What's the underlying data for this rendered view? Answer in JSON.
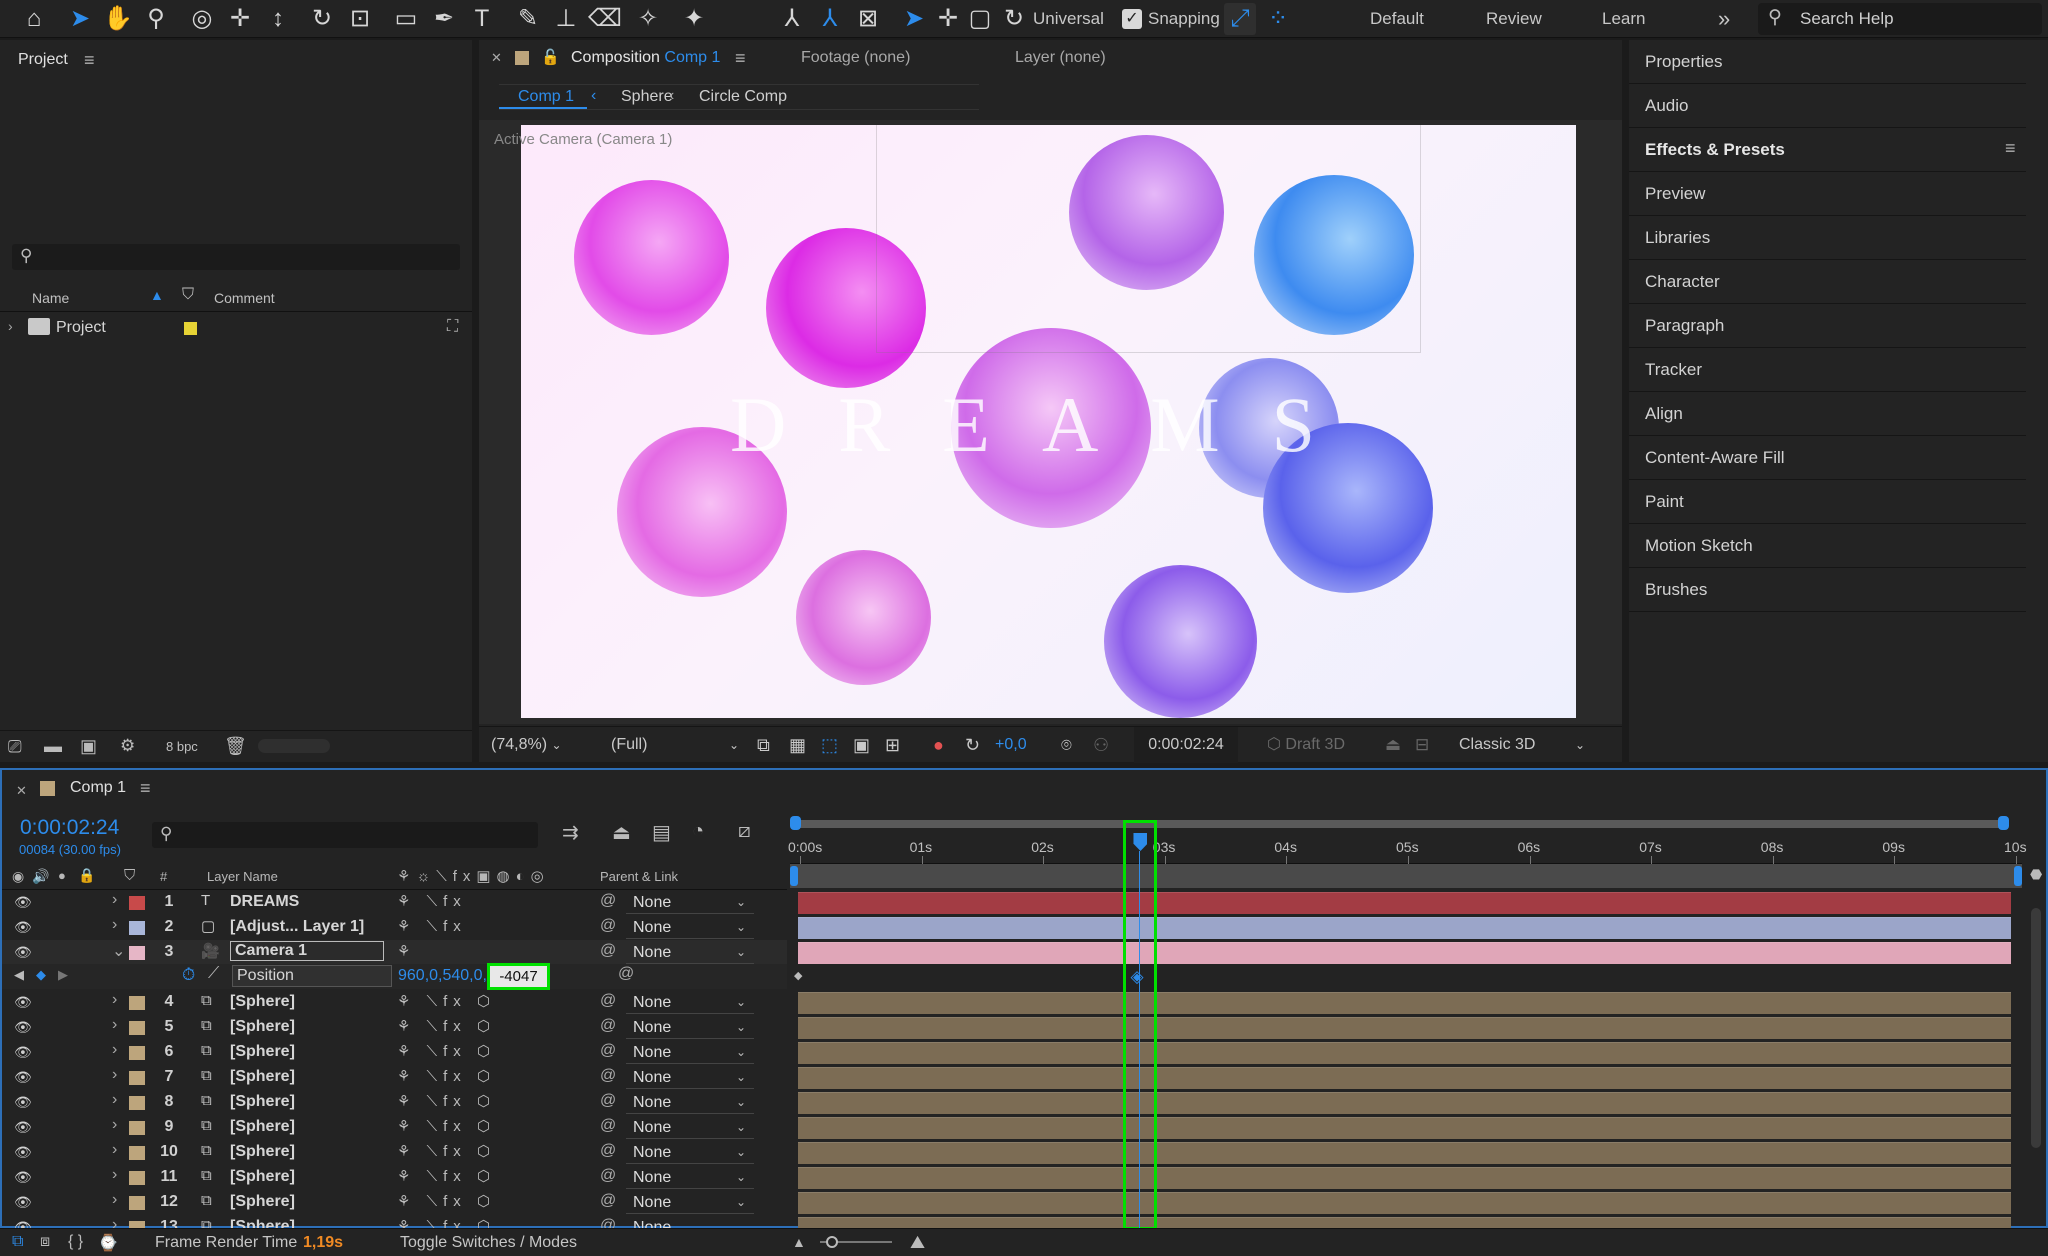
{
  "toolbar": {
    "axis_mode": "Universal",
    "snapping": "Snapping",
    "workspaces": [
      "Default",
      "Review",
      "Learn"
    ],
    "more": "»",
    "search_placeholder": "Search Help"
  },
  "project": {
    "title": "Project",
    "search_placeholder": "",
    "columns": {
      "name": "Name",
      "comment": "Comment"
    },
    "items": [
      {
        "name": "Project",
        "label_color": "#e6d335"
      }
    ],
    "bpc": "8 bpc"
  },
  "viewer": {
    "tab_composition": "Composition",
    "tab_comp_name": "Comp 1",
    "tab_footage": "Footage (none)",
    "tab_layer": "Layer (none)",
    "breadcrumbs": [
      "Comp 1",
      "Sphere",
      "Circle Comp"
    ],
    "camera_label": "Active Camera (Camera 1)",
    "canvas_text": "DREAMS",
    "zoom": "(74,8%)",
    "resolution": "(Full)",
    "exposure": "+0,0",
    "timecode": "0:00:02:24",
    "draft3d": "Draft 3D",
    "renderer": "Classic 3D"
  },
  "right_panel": {
    "items": [
      "Properties",
      "Audio",
      "Effects & Presets",
      "Preview",
      "Libraries",
      "Character",
      "Paragraph",
      "Tracker",
      "Align",
      "Content-Aware Fill",
      "Paint",
      "Motion Sketch",
      "Brushes"
    ]
  },
  "timeline": {
    "tab": "Comp 1",
    "timecode": "0:00:02:24",
    "frames": "00084 (30.00 fps)",
    "search_placeholder": "",
    "col_hash": "#",
    "col_layer_name": "Layer Name",
    "col_parent": "Parent & Link",
    "ruler": [
      "0:00s",
      "01s",
      "02s",
      "03s",
      "04s",
      "05s",
      "06s",
      "07s",
      "08s",
      "09s",
      "10s"
    ],
    "playhead_seconds": 2.8,
    "layers": [
      {
        "num": "1",
        "name": "DREAMS",
        "type": "T",
        "color": "#c84a4a",
        "parent": "None"
      },
      {
        "num": "2",
        "name": "[Adjust... Layer 1]",
        "type": "adj",
        "color": "#a9b6d9",
        "parent": "None"
      },
      {
        "num": "3",
        "name": "Camera 1",
        "type": "cam",
        "color": "#e6b6c6",
        "parent": "None"
      },
      {
        "num": "4",
        "name": "[Sphere]",
        "type": "comp",
        "color": "#bda57c",
        "parent": "None"
      },
      {
        "num": "5",
        "name": "[Sphere]",
        "type": "comp",
        "color": "#bda57c",
        "parent": "None"
      },
      {
        "num": "6",
        "name": "[Sphere]",
        "type": "comp",
        "color": "#bda57c",
        "parent": "None"
      },
      {
        "num": "7",
        "name": "[Sphere]",
        "type": "comp",
        "color": "#bda57c",
        "parent": "None"
      },
      {
        "num": "8",
        "name": "[Sphere]",
        "type": "comp",
        "color": "#bda57c",
        "parent": "None"
      },
      {
        "num": "9",
        "name": "[Sphere]",
        "type": "comp",
        "color": "#bda57c",
        "parent": "None"
      },
      {
        "num": "10",
        "name": "[Sphere]",
        "type": "comp",
        "color": "#bda57c",
        "parent": "None"
      },
      {
        "num": "11",
        "name": "[Sphere]",
        "type": "comp",
        "color": "#bda57c",
        "parent": "None"
      },
      {
        "num": "12",
        "name": "[Sphere]",
        "type": "comp",
        "color": "#bda57c",
        "parent": "None"
      },
      {
        "num": "13",
        "name": "[Sphere]",
        "type": "comp",
        "color": "#bda57c",
        "parent": "None"
      }
    ],
    "property": {
      "name": "Position",
      "value_xy": "960,0,540,0,",
      "value_z": "-4047"
    },
    "frame_render_label": "Frame Render Time",
    "frame_render_value": "1,19s",
    "toggle_label": "Toggle Switches / Modes"
  },
  "colors": {
    "accent": "#2d8ceb",
    "highlight": "#00e000",
    "layer_bar_text": "#a33c44",
    "layer_bar_adj": "#9ba5c9",
    "layer_bar_cam": "#e0a6b8",
    "layer_bar_comp": "#7c6c54"
  }
}
